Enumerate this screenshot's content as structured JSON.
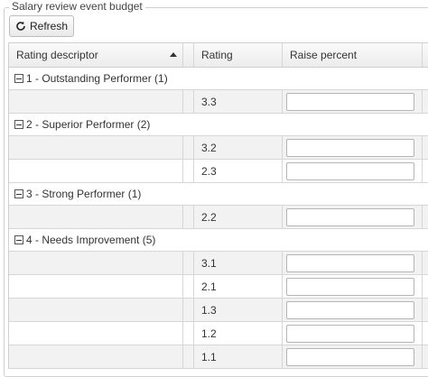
{
  "panel": {
    "title": "Salary review event budget"
  },
  "toolbar": {
    "refresh_label": "Refresh"
  },
  "grid": {
    "columns": [
      "Rating descriptor",
      "Rating",
      "Raise percent"
    ],
    "groups": [
      {
        "label": "1 - Outstanding Performer (1)",
        "rows": [
          {
            "rating": "3.3",
            "raise": ""
          }
        ]
      },
      {
        "label": "2 - Superior Performer (2)",
        "rows": [
          {
            "rating": "3.2",
            "raise": ""
          },
          {
            "rating": "2.3",
            "raise": ""
          }
        ]
      },
      {
        "label": "3 - Strong Performer (1)",
        "rows": [
          {
            "rating": "2.2",
            "raise": ""
          }
        ]
      },
      {
        "label": "4 - Needs Improvement (5)",
        "rows": [
          {
            "rating": "3.1",
            "raise": ""
          },
          {
            "rating": "2.1",
            "raise": ""
          },
          {
            "rating": "1.3",
            "raise": ""
          },
          {
            "rating": "1.2",
            "raise": ""
          },
          {
            "rating": "1.1",
            "raise": ""
          }
        ]
      }
    ]
  }
}
